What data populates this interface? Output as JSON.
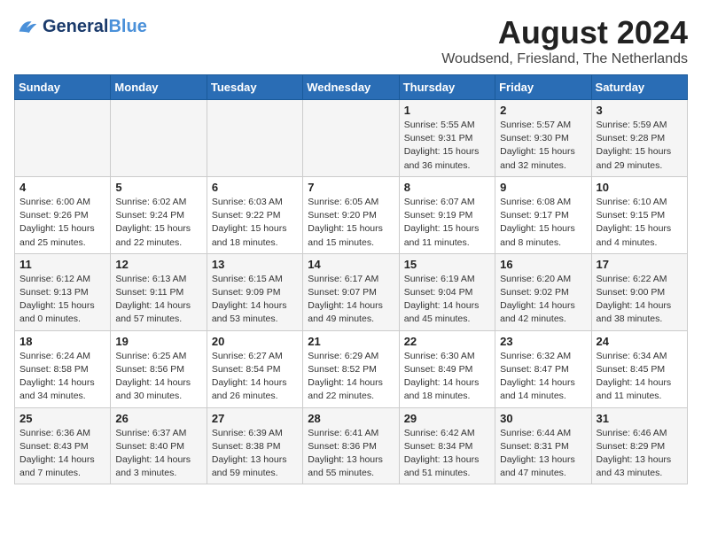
{
  "header": {
    "logo_general": "General",
    "logo_blue": "Blue",
    "month_year": "August 2024",
    "location": "Woudsend, Friesland, The Netherlands"
  },
  "weekdays": [
    "Sunday",
    "Monday",
    "Tuesday",
    "Wednesday",
    "Thursday",
    "Friday",
    "Saturday"
  ],
  "weeks": [
    [
      {
        "day": "",
        "info": ""
      },
      {
        "day": "",
        "info": ""
      },
      {
        "day": "",
        "info": ""
      },
      {
        "day": "",
        "info": ""
      },
      {
        "day": "1",
        "info": "Sunrise: 5:55 AM\nSunset: 9:31 PM\nDaylight: 15 hours\nand 36 minutes."
      },
      {
        "day": "2",
        "info": "Sunrise: 5:57 AM\nSunset: 9:30 PM\nDaylight: 15 hours\nand 32 minutes."
      },
      {
        "day": "3",
        "info": "Sunrise: 5:59 AM\nSunset: 9:28 PM\nDaylight: 15 hours\nand 29 minutes."
      }
    ],
    [
      {
        "day": "4",
        "info": "Sunrise: 6:00 AM\nSunset: 9:26 PM\nDaylight: 15 hours\nand 25 minutes."
      },
      {
        "day": "5",
        "info": "Sunrise: 6:02 AM\nSunset: 9:24 PM\nDaylight: 15 hours\nand 22 minutes."
      },
      {
        "day": "6",
        "info": "Sunrise: 6:03 AM\nSunset: 9:22 PM\nDaylight: 15 hours\nand 18 minutes."
      },
      {
        "day": "7",
        "info": "Sunrise: 6:05 AM\nSunset: 9:20 PM\nDaylight: 15 hours\nand 15 minutes."
      },
      {
        "day": "8",
        "info": "Sunrise: 6:07 AM\nSunset: 9:19 PM\nDaylight: 15 hours\nand 11 minutes."
      },
      {
        "day": "9",
        "info": "Sunrise: 6:08 AM\nSunset: 9:17 PM\nDaylight: 15 hours\nand 8 minutes."
      },
      {
        "day": "10",
        "info": "Sunrise: 6:10 AM\nSunset: 9:15 PM\nDaylight: 15 hours\nand 4 minutes."
      }
    ],
    [
      {
        "day": "11",
        "info": "Sunrise: 6:12 AM\nSunset: 9:13 PM\nDaylight: 15 hours\nand 0 minutes."
      },
      {
        "day": "12",
        "info": "Sunrise: 6:13 AM\nSunset: 9:11 PM\nDaylight: 14 hours\nand 57 minutes."
      },
      {
        "day": "13",
        "info": "Sunrise: 6:15 AM\nSunset: 9:09 PM\nDaylight: 14 hours\nand 53 minutes."
      },
      {
        "day": "14",
        "info": "Sunrise: 6:17 AM\nSunset: 9:07 PM\nDaylight: 14 hours\nand 49 minutes."
      },
      {
        "day": "15",
        "info": "Sunrise: 6:19 AM\nSunset: 9:04 PM\nDaylight: 14 hours\nand 45 minutes."
      },
      {
        "day": "16",
        "info": "Sunrise: 6:20 AM\nSunset: 9:02 PM\nDaylight: 14 hours\nand 42 minutes."
      },
      {
        "day": "17",
        "info": "Sunrise: 6:22 AM\nSunset: 9:00 PM\nDaylight: 14 hours\nand 38 minutes."
      }
    ],
    [
      {
        "day": "18",
        "info": "Sunrise: 6:24 AM\nSunset: 8:58 PM\nDaylight: 14 hours\nand 34 minutes."
      },
      {
        "day": "19",
        "info": "Sunrise: 6:25 AM\nSunset: 8:56 PM\nDaylight: 14 hours\nand 30 minutes."
      },
      {
        "day": "20",
        "info": "Sunrise: 6:27 AM\nSunset: 8:54 PM\nDaylight: 14 hours\nand 26 minutes."
      },
      {
        "day": "21",
        "info": "Sunrise: 6:29 AM\nSunset: 8:52 PM\nDaylight: 14 hours\nand 22 minutes."
      },
      {
        "day": "22",
        "info": "Sunrise: 6:30 AM\nSunset: 8:49 PM\nDaylight: 14 hours\nand 18 minutes."
      },
      {
        "day": "23",
        "info": "Sunrise: 6:32 AM\nSunset: 8:47 PM\nDaylight: 14 hours\nand 14 minutes."
      },
      {
        "day": "24",
        "info": "Sunrise: 6:34 AM\nSunset: 8:45 PM\nDaylight: 14 hours\nand 11 minutes."
      }
    ],
    [
      {
        "day": "25",
        "info": "Sunrise: 6:36 AM\nSunset: 8:43 PM\nDaylight: 14 hours\nand 7 minutes."
      },
      {
        "day": "26",
        "info": "Sunrise: 6:37 AM\nSunset: 8:40 PM\nDaylight: 14 hours\nand 3 minutes."
      },
      {
        "day": "27",
        "info": "Sunrise: 6:39 AM\nSunset: 8:38 PM\nDaylight: 13 hours\nand 59 minutes."
      },
      {
        "day": "28",
        "info": "Sunrise: 6:41 AM\nSunset: 8:36 PM\nDaylight: 13 hours\nand 55 minutes."
      },
      {
        "day": "29",
        "info": "Sunrise: 6:42 AM\nSunset: 8:34 PM\nDaylight: 13 hours\nand 51 minutes."
      },
      {
        "day": "30",
        "info": "Sunrise: 6:44 AM\nSunset: 8:31 PM\nDaylight: 13 hours\nand 47 minutes."
      },
      {
        "day": "31",
        "info": "Sunrise: 6:46 AM\nSunset: 8:29 PM\nDaylight: 13 hours\nand 43 minutes."
      }
    ]
  ]
}
